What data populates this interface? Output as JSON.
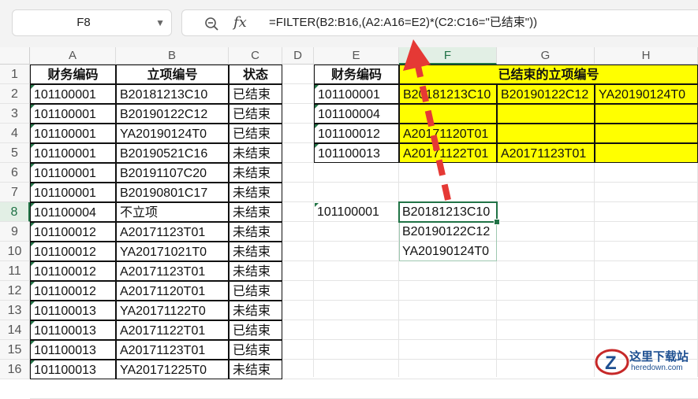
{
  "formula_bar": {
    "name_box": "F8",
    "fx_label": "fx",
    "formula": "=FILTER(B2:B16,(A2:A16=E2)*(C2:C16=\"已结束\"))"
  },
  "columns": [
    "A",
    "B",
    "C",
    "D",
    "E",
    "F",
    "G",
    "H"
  ],
  "rows": [
    "1",
    "2",
    "3",
    "4",
    "5",
    "6",
    "7",
    "8",
    "9",
    "10",
    "11",
    "12",
    "13",
    "14",
    "15",
    "16"
  ],
  "left_table": {
    "headers": [
      "财务编码",
      "立项编号",
      "状态"
    ],
    "rows": [
      [
        "101100001",
        "B20181213C10",
        "已结束"
      ],
      [
        "101100001",
        "B20190122C12",
        "已结束"
      ],
      [
        "101100001",
        "YA20190124T0",
        "已结束"
      ],
      [
        "101100001",
        "B20190521C16",
        "未结束"
      ],
      [
        "101100001",
        "B20191107C20",
        "未结束"
      ],
      [
        "101100001",
        "B20190801C17",
        "未结束"
      ],
      [
        "101100004",
        "不立项",
        "未结束"
      ],
      [
        "101100012",
        "A20171123T01",
        "未结束"
      ],
      [
        "101100012",
        "YA20171021T0",
        "未结束"
      ],
      [
        "101100012",
        "A20171123T01",
        "未结束"
      ],
      [
        "101100012",
        "A20171120T01",
        "已结束"
      ],
      [
        "101100013",
        "YA20171122T0",
        "未结束"
      ],
      [
        "101100013",
        "A20171122T01",
        "已结束"
      ],
      [
        "101100013",
        "A20171123T01",
        "已结束"
      ],
      [
        "101100013",
        "YA20171225T0",
        "未结束"
      ]
    ]
  },
  "right_table": {
    "header_code": "财务编码",
    "header_ids": "已结束的立项编号",
    "rows": [
      {
        "code": "101100001",
        "ids": [
          "B20181213C10",
          "B20190122C12",
          "YA20190124T0"
        ]
      },
      {
        "code": "101100004",
        "ids": [
          "",
          "",
          ""
        ]
      },
      {
        "code": "101100012",
        "ids": [
          "A20171120T01",
          "",
          ""
        ]
      },
      {
        "code": "101100013",
        "ids": [
          "A20171122T01",
          "A20171123T01",
          ""
        ]
      }
    ]
  },
  "filter_demo": {
    "code": "101100001",
    "results": [
      "B20181213C10",
      "B20190122C12",
      "YA20190124T0"
    ]
  },
  "watermark": {
    "title": "这里下载站",
    "url": "heredown.com"
  },
  "colors": {
    "accent": "#217346",
    "highlight": "#ffff00",
    "arrow": "#e53935"
  }
}
